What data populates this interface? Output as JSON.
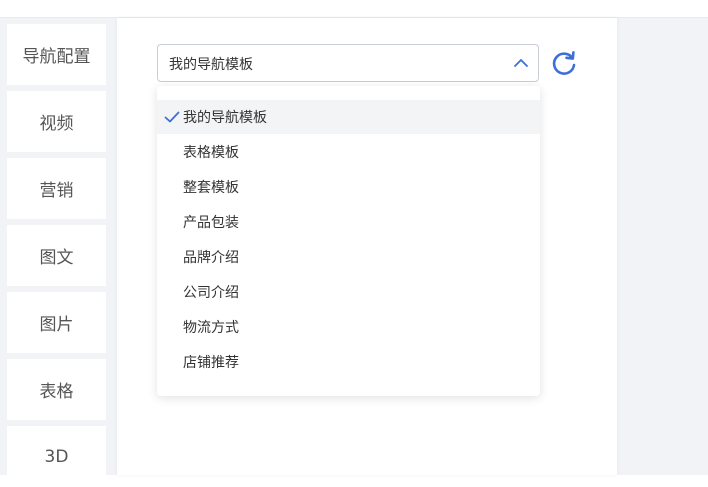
{
  "sidebar": {
    "items": [
      {
        "label": "导航配置"
      },
      {
        "label": "视频"
      },
      {
        "label": "营销"
      },
      {
        "label": "图文"
      },
      {
        "label": "图片"
      },
      {
        "label": "表格"
      },
      {
        "label": "3D"
      }
    ]
  },
  "template_select": {
    "value": "我的导航模板",
    "options": [
      {
        "label": "我的导航模板",
        "selected": true
      },
      {
        "label": "表格模板"
      },
      {
        "label": "整套模板"
      },
      {
        "label": "产品包装"
      },
      {
        "label": "品牌介绍"
      },
      {
        "label": "公司介绍"
      },
      {
        "label": "物流方式"
      },
      {
        "label": "店铺推荐"
      }
    ]
  },
  "icons": {
    "dropdown_arrow": "chevron-up-icon",
    "refresh": "refresh-icon",
    "selected_mark": "checkmark-icon"
  },
  "colors": {
    "accent": "#3d6fd6",
    "text": "#333333",
    "nav_text": "#555555",
    "background": "#f2f3f6",
    "selected_bg": "#f3f4f6"
  }
}
